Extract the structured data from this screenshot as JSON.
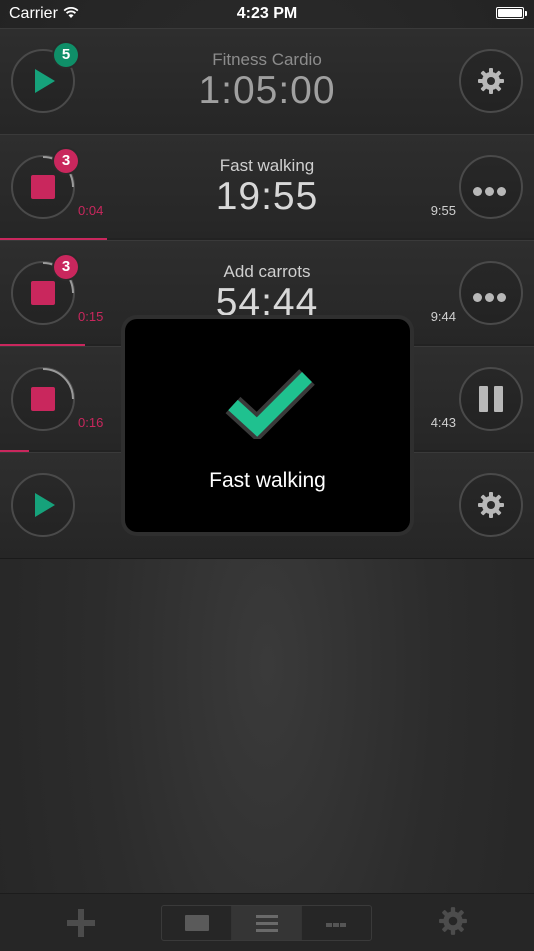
{
  "status_bar": {
    "carrier": "Carrier",
    "time": "4:23 PM"
  },
  "timers": [
    {
      "name": "Fitness Cardio",
      "time": "1:05:00",
      "badge": "5",
      "elapsed": "",
      "remaining": "",
      "state": "stopped",
      "action": "gear",
      "progress": 0
    },
    {
      "name": "Fast walking",
      "time": "19:55",
      "badge": "3",
      "elapsed": "0:04",
      "remaining": "9:55",
      "state": "running",
      "action": "more",
      "progress": 0.2
    },
    {
      "name": "Add carrots",
      "time": "54:44",
      "badge": "3",
      "elapsed": "0:15",
      "remaining": "9:44",
      "state": "running",
      "action": "more",
      "progress": 0.16
    },
    {
      "name": "",
      "time": "",
      "badge": "",
      "elapsed": "0:16",
      "remaining": "4:43",
      "state": "running",
      "action": "pause",
      "progress": 0.055
    },
    {
      "name": "",
      "time": "",
      "badge": "",
      "elapsed": "",
      "remaining": "",
      "state": "stopped",
      "action": "gear",
      "progress": 0
    }
  ],
  "hud": {
    "message": "Fast walking",
    "icon": "checkmark-icon"
  },
  "toolbar": {
    "add_icon": "plus-icon",
    "view_modes": [
      "single-view-icon",
      "list-view-icon",
      "grid-view-icon"
    ],
    "active_view": "list",
    "settings_icon": "gear-icon"
  },
  "colors": {
    "accent_green": "#16a27b",
    "accent_pink": "#c9275d",
    "check_green": "#1fc18f"
  }
}
